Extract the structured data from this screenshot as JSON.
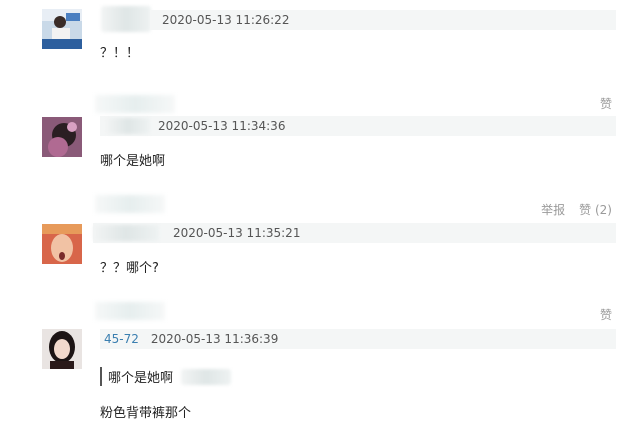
{
  "comments": [
    {
      "time": "2020-05-13 11:26:22",
      "text": "？！！",
      "actions": []
    },
    {
      "time": "2020-05-13 11:34:36",
      "text": "哪个是她啊",
      "actions": [
        "赞"
      ]
    },
    {
      "time": "2020-05-13 11:35:21",
      "text": "？？哪个?",
      "actions": [
        "举报",
        "赞 (2)"
      ]
    },
    {
      "user_prefix": "45-72",
      "time": "2020-05-13 11:36:39",
      "quote": "哪个是她啊",
      "text": "粉色背带裤那个",
      "actions": [
        "赞"
      ]
    }
  ],
  "colors": {
    "meta_bar": "#f4f6f6",
    "link": "#3b7fb0",
    "muted": "#9a9a9a"
  }
}
